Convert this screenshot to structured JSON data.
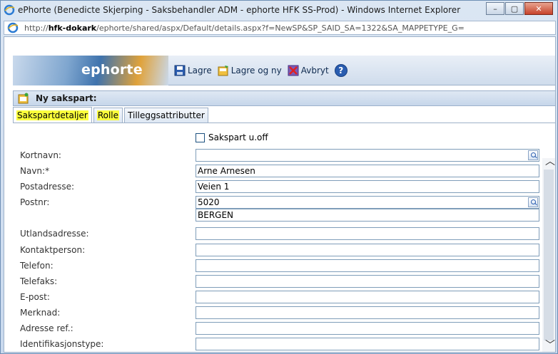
{
  "window": {
    "title": "ePhorte (Benedicte Skjerping - Saksbehandler ADM - ephorte HFK SS-Prod) - Windows Internet Explorer",
    "minimize": "–",
    "maximize": "▢",
    "close": "✕"
  },
  "address": {
    "prefix": "http://",
    "host": "hfk-dokark",
    "path": "/ephorte/shared/aspx/Default/details.aspx?f=NewSP&SP_SAID_SA=1322&SA_MAPPETYPE_G="
  },
  "app": {
    "logo": "ephorte",
    "toolbar": {
      "save": "Lagre",
      "save_new": "Lagre og ny",
      "cancel": "Avbryt"
    },
    "section_title": "Ny sakspart:"
  },
  "tabs": [
    {
      "label": "Sakspartdetaljer"
    },
    {
      "label": "Rolle"
    },
    {
      "label": "Tilleggsattributter"
    }
  ],
  "form": {
    "checkbox_label": "Sakspart u.off",
    "rows": [
      {
        "label": "Kortnavn:",
        "value": ""
      },
      {
        "label": "Navn:*",
        "value": "Arne Arnesen"
      },
      {
        "label": "Postadresse:",
        "value": "Veien 1"
      },
      {
        "label": "Postnr:",
        "value": "5020"
      },
      {
        "label": "",
        "value": "BERGEN"
      },
      {
        "label": "Utlandsadresse:",
        "value": ""
      },
      {
        "label": "Kontaktperson:",
        "value": ""
      },
      {
        "label": "Telefon:",
        "value": ""
      },
      {
        "label": "Telefaks:",
        "value": ""
      },
      {
        "label": "E-post:",
        "value": ""
      },
      {
        "label": "Merknad:",
        "value": ""
      },
      {
        "label": "Adresse ref.:",
        "value": ""
      },
      {
        "label": "Identifikasjonstype:",
        "value": ""
      }
    ]
  },
  "colors": {
    "highlight": "#fbff3c",
    "header_blue": "#3f73ad",
    "accent_orange": "#e0a23a"
  }
}
